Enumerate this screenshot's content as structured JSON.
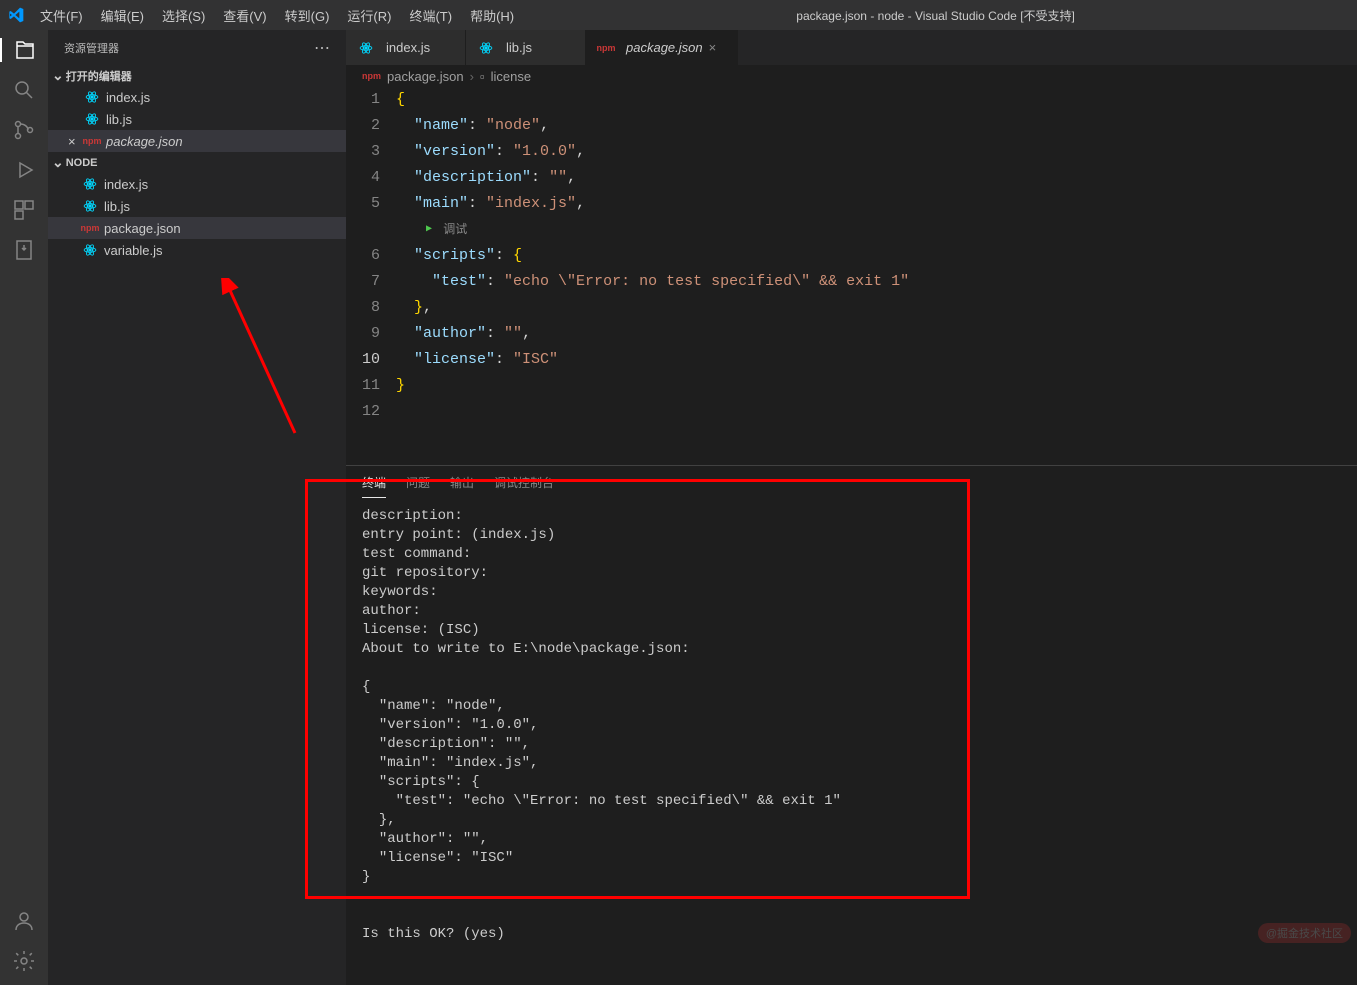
{
  "title": "package.json - node - Visual Studio Code [不受支持]",
  "menu": [
    "文件(F)",
    "编辑(E)",
    "选择(S)",
    "查看(V)",
    "转到(G)",
    "运行(R)",
    "终端(T)",
    "帮助(H)"
  ],
  "sidebar": {
    "title": "资源管理器",
    "openEditors": {
      "label": "打开的编辑器",
      "items": [
        {
          "icon": "react",
          "name": "index.js"
        },
        {
          "icon": "react",
          "name": "lib.js"
        },
        {
          "icon": "npm",
          "name": "package.json",
          "active": true
        }
      ]
    },
    "folder": {
      "label": "NODE",
      "items": [
        {
          "icon": "react",
          "name": "index.js"
        },
        {
          "icon": "react",
          "name": "lib.js"
        },
        {
          "icon": "npm",
          "name": "package.json",
          "active": true
        },
        {
          "icon": "react",
          "name": "variable.js"
        }
      ]
    }
  },
  "tabs": [
    {
      "icon": "react",
      "name": "index.js"
    },
    {
      "icon": "react",
      "name": "lib.js"
    },
    {
      "icon": "npm",
      "name": "package.json",
      "active": true
    }
  ],
  "breadcrumb": {
    "file": "package.json",
    "symbol": "license"
  },
  "code": {
    "lines": [
      {
        "n": 1,
        "t": "{"
      },
      {
        "n": 2,
        "k": "name",
        "v": "node",
        "c": true
      },
      {
        "n": 3,
        "k": "version",
        "v": "1.0.0",
        "c": true
      },
      {
        "n": 4,
        "k": "description",
        "v": "",
        "c": true
      },
      {
        "n": 5,
        "k": "main",
        "v": "index.js",
        "c": true
      },
      {
        "n": 0,
        "debug": "调试"
      },
      {
        "n": 6,
        "k": "scripts",
        "obj": true
      },
      {
        "n": 7,
        "k2": "test",
        "v2": "echo \\\"Error: no test specified\\\" && exit 1"
      },
      {
        "n": 8,
        "close": true,
        "c": true
      },
      {
        "n": 9,
        "k": "author",
        "v": "",
        "c": true
      },
      {
        "n": 10,
        "k": "license",
        "v": "ISC",
        "cur": true
      },
      {
        "n": 11,
        "t": "}"
      },
      {
        "n": 12,
        "t": ""
      }
    ]
  },
  "panel": {
    "tabs": [
      "终端",
      "问题",
      "输出",
      "调试控制台"
    ],
    "active": 0,
    "terminal": "description:\nentry point: (index.js)\ntest command:\ngit repository:\nkeywords:\nauthor:\nlicense: (ISC)\nAbout to write to E:\\node\\package.json:\n\n{\n  \"name\": \"node\",\n  \"version\": \"1.0.0\",\n  \"description\": \"\",\n  \"main\": \"index.js\",\n  \"scripts\": {\n    \"test\": \"echo \\\"Error: no test specified\\\" && exit 1\"\n  },\n  \"author\": \"\",\n  \"license\": \"ISC\"\n}\n\n\nIs this OK? (yes)"
  },
  "watermark": "@掘金技术社区"
}
